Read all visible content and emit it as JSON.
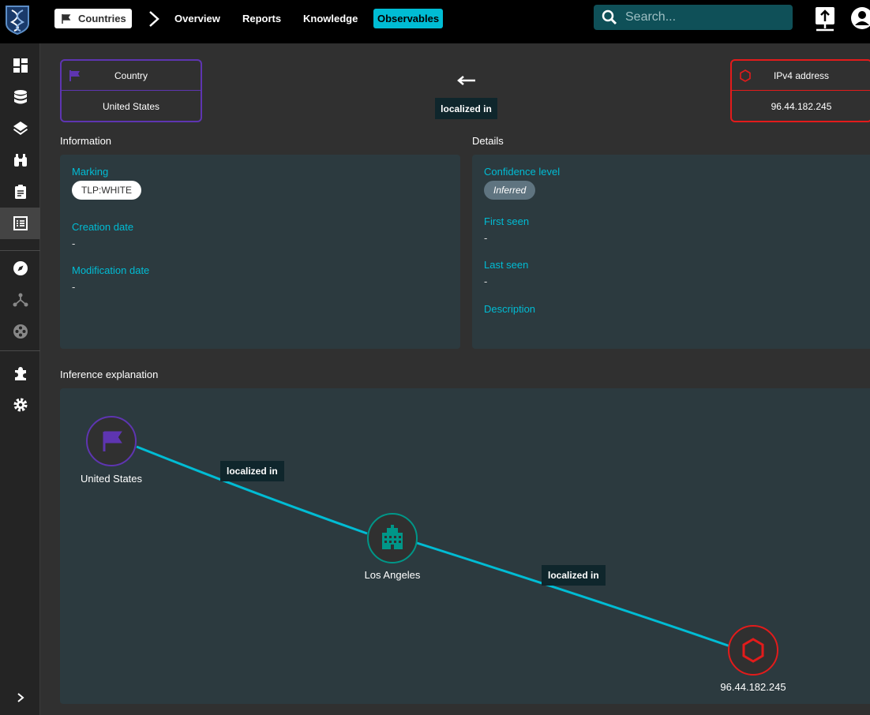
{
  "header": {
    "breadcrumb_chip": "Countries",
    "nav": [
      "Overview",
      "Reports",
      "Knowledge",
      "Observables"
    ],
    "active_nav": "Observables",
    "search_placeholder": "Search..."
  },
  "relationship": {
    "source": {
      "type": "Country",
      "name": "United States"
    },
    "target": {
      "type": "IPv4 address",
      "name": "96.44.182.245"
    },
    "label": "localized in"
  },
  "information": {
    "title": "Information",
    "marking_label": "Marking",
    "marking": "TLP:WHITE",
    "creation_label": "Creation date",
    "creation": "-",
    "modification_label": "Modification date",
    "modification": "-"
  },
  "details": {
    "title": "Details",
    "confidence_label": "Confidence level",
    "confidence": "Inferred",
    "first_seen_label": "First seen",
    "first_seen": "-",
    "last_seen_label": "Last seen",
    "last_seen": "-",
    "description_label": "Description"
  },
  "inference": {
    "title": "Inference explanation",
    "nodes": [
      "United States",
      "Los Angeles",
      "96.44.182.245"
    ],
    "edges": [
      "localized in",
      "localized in"
    ]
  },
  "colors": {
    "country": "#5e35b1",
    "city": "#009688",
    "ipv4": "#e31b1b",
    "accent": "#00bcd4"
  }
}
